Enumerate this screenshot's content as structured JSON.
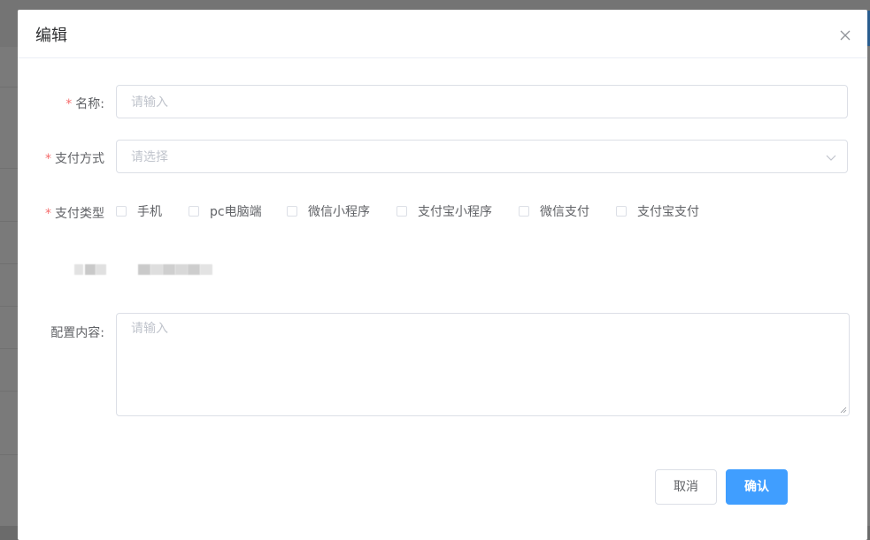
{
  "dialog": {
    "title": "编辑",
    "close_icon": "close-icon"
  },
  "form": {
    "name": {
      "label": "名称:",
      "required_mark": "*",
      "placeholder": "请输入",
      "value": ""
    },
    "pay_method": {
      "label": "支付方式",
      "required_mark": "*",
      "placeholder": "请选择",
      "value": ""
    },
    "pay_type": {
      "label": "支付类型",
      "required_mark": "*",
      "options": [
        {
          "label": "手机",
          "checked": false
        },
        {
          "label": "pc电脑端",
          "checked": false
        },
        {
          "label": "微信小程序",
          "checked": false
        },
        {
          "label": "支付宝小程序",
          "checked": false
        },
        {
          "label": "微信支付",
          "checked": false
        },
        {
          "label": "支付宝支付",
          "checked": false
        }
      ]
    },
    "config": {
      "label": "配置内容:",
      "placeholder": "请输入",
      "value": ""
    }
  },
  "footer": {
    "cancel_label": "取消",
    "confirm_label": "确认"
  },
  "colors": {
    "primary": "#409eff",
    "required": "#f56c6c",
    "border": "#dcdfe6",
    "placeholder": "#c0c4cc"
  }
}
